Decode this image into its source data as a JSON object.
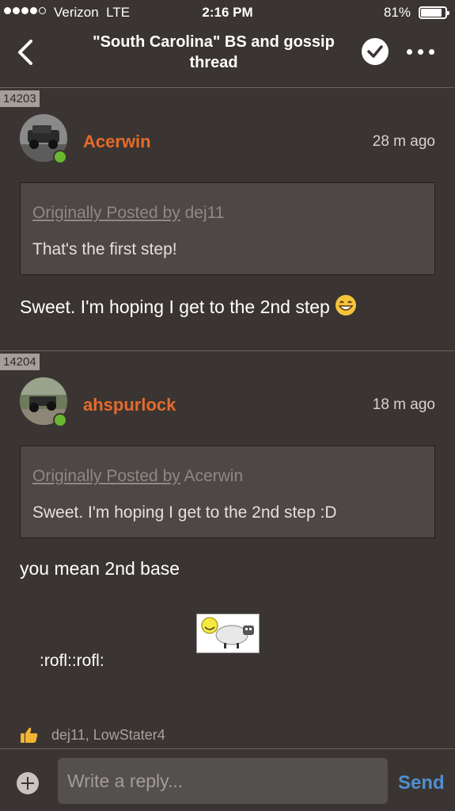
{
  "status_bar": {
    "carrier": "Verizon",
    "network": "LTE",
    "time": "2:16 PM",
    "battery_percent": "81%",
    "battery_level": 0.81
  },
  "nav": {
    "title": "\"South Carolina\" BS and gossip thread",
    "back_icon": "chevron-left-icon",
    "check_icon": "checkmark-circle-icon",
    "more_icon": "more-dots-icon"
  },
  "posts": [
    {
      "number": "14203",
      "author": "Acerwin",
      "time": "28 m ago",
      "quote_prefix": "Originally Posted by",
      "quote_author": "dej11",
      "quote_text": "That's the first step!",
      "body": "Sweet. I'm hoping I get to the 2nd step",
      "emoji": "grinning-face-icon"
    },
    {
      "number": "14204",
      "author": "ahspurlock",
      "time": "18 m ago",
      "quote_prefix": "Originally Posted by",
      "quote_author": "Acerwin",
      "quote_text": "Sweet. I'm hoping I get to the 2nd step :D",
      "body": "you mean 2nd base",
      "smiley_icon": "rofl-sheep-smiley-icon",
      "body2": ":rofl::rofl:",
      "likes_icon": "thumbs-up-icon",
      "likes": "dej11, LowStater4"
    }
  ],
  "composer": {
    "placeholder": "Write a reply...",
    "send_label": "Send",
    "attach_icon": "plus-circle-icon"
  },
  "colors": {
    "background": "#3a3532",
    "author": "#e46b2b",
    "accent": "#4f8fd1",
    "online": "#67b82f"
  }
}
